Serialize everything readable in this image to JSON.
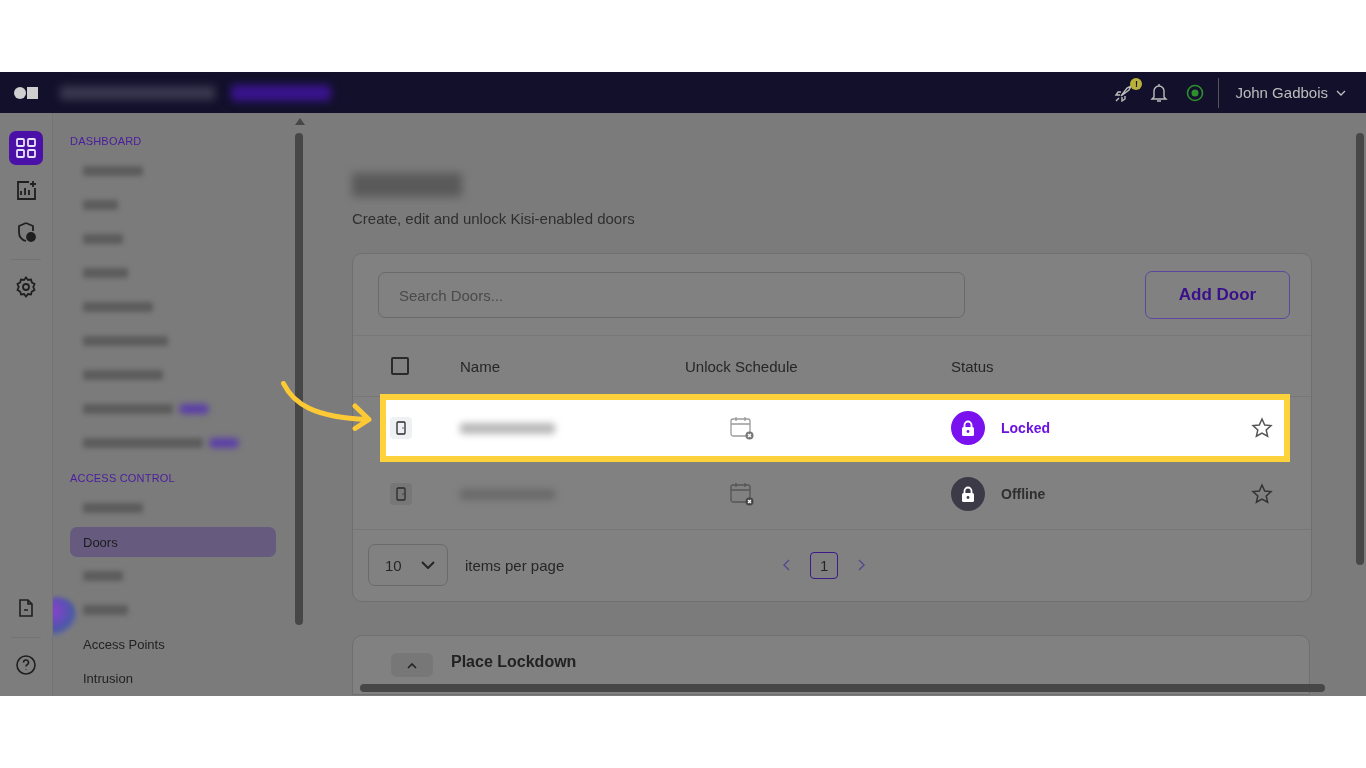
{
  "topbar": {
    "badge": "!",
    "user": "John Gadbois"
  },
  "rail": [
    {
      "kind": "grid",
      "selected": true
    },
    {
      "kind": "chart",
      "selected": false
    },
    {
      "kind": "shield",
      "selected": false
    },
    {
      "kind": "gear",
      "selected": false
    }
  ],
  "rail_bottom": [
    {
      "kind": "document"
    },
    {
      "kind": "help"
    }
  ],
  "nav": [
    {
      "heading": "DASHBOARD",
      "items": [
        {
          "kind": "redacted"
        },
        {
          "kind": "redacted"
        },
        {
          "kind": "redacted"
        },
        {
          "kind": "redacted"
        },
        {
          "kind": "redacted"
        },
        {
          "kind": "redacted"
        },
        {
          "kind": "redacted"
        },
        {
          "kind": "redacted_badge"
        },
        {
          "kind": "redacted_badge"
        }
      ]
    },
    {
      "heading": "ACCESS CONTROL",
      "items": [
        {
          "kind": "redacted"
        },
        {
          "kind": "link",
          "label": "Doors",
          "selected": true
        },
        {
          "kind": "redacted"
        },
        {
          "kind": "redacted"
        },
        {
          "kind": "link",
          "label": "Access Points",
          "selected": false
        },
        {
          "kind": "link",
          "label": "Intrusion",
          "selected": false
        }
      ]
    }
  ],
  "page": {
    "subtitle": "Create, edit and unlock Kisi-enabled doors"
  },
  "doors": {
    "search": {
      "placeholder": "Search Doors..."
    },
    "add_button": "Add Door",
    "select_all": {
      "checked": false
    },
    "columns": [
      "Name",
      "Unlock Schedule",
      "Status"
    ],
    "rows": [
      {
        "highlighted": true,
        "status": "Locked",
        "kind": "locked",
        "starred": false
      },
      {
        "highlighted": false,
        "status": "Offline",
        "kind": "offline",
        "starred": false
      }
    ],
    "per_page": "10",
    "per_page_label": "items per page",
    "pages": [
      {
        "label": "1",
        "selected": true
      }
    ]
  },
  "lockdown": {
    "title": "Place Lockdown"
  }
}
